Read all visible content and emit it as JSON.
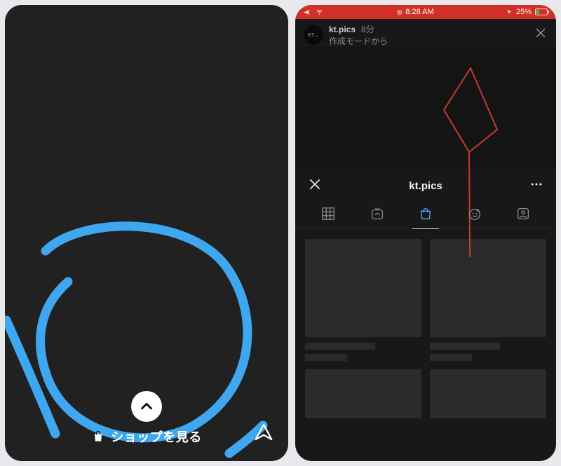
{
  "left": {
    "swipe_label": "ショップを見る",
    "annotation_color": "#3ea7f0"
  },
  "right": {
    "status": {
      "time": "8:28 AM",
      "battery": "25%"
    },
    "story": {
      "avatar_text": "KT…",
      "username": "kt.pics",
      "time_ago": "8分",
      "subtitle": "作成モードから"
    },
    "sheet": {
      "title": "kt.pics",
      "tabs": {
        "grid": "grid",
        "igtv": "igtv",
        "shop": "shop",
        "effects": "effects",
        "tagged": "tagged",
        "active": "shop"
      }
    },
    "annotation_color": "#c33a2e"
  }
}
